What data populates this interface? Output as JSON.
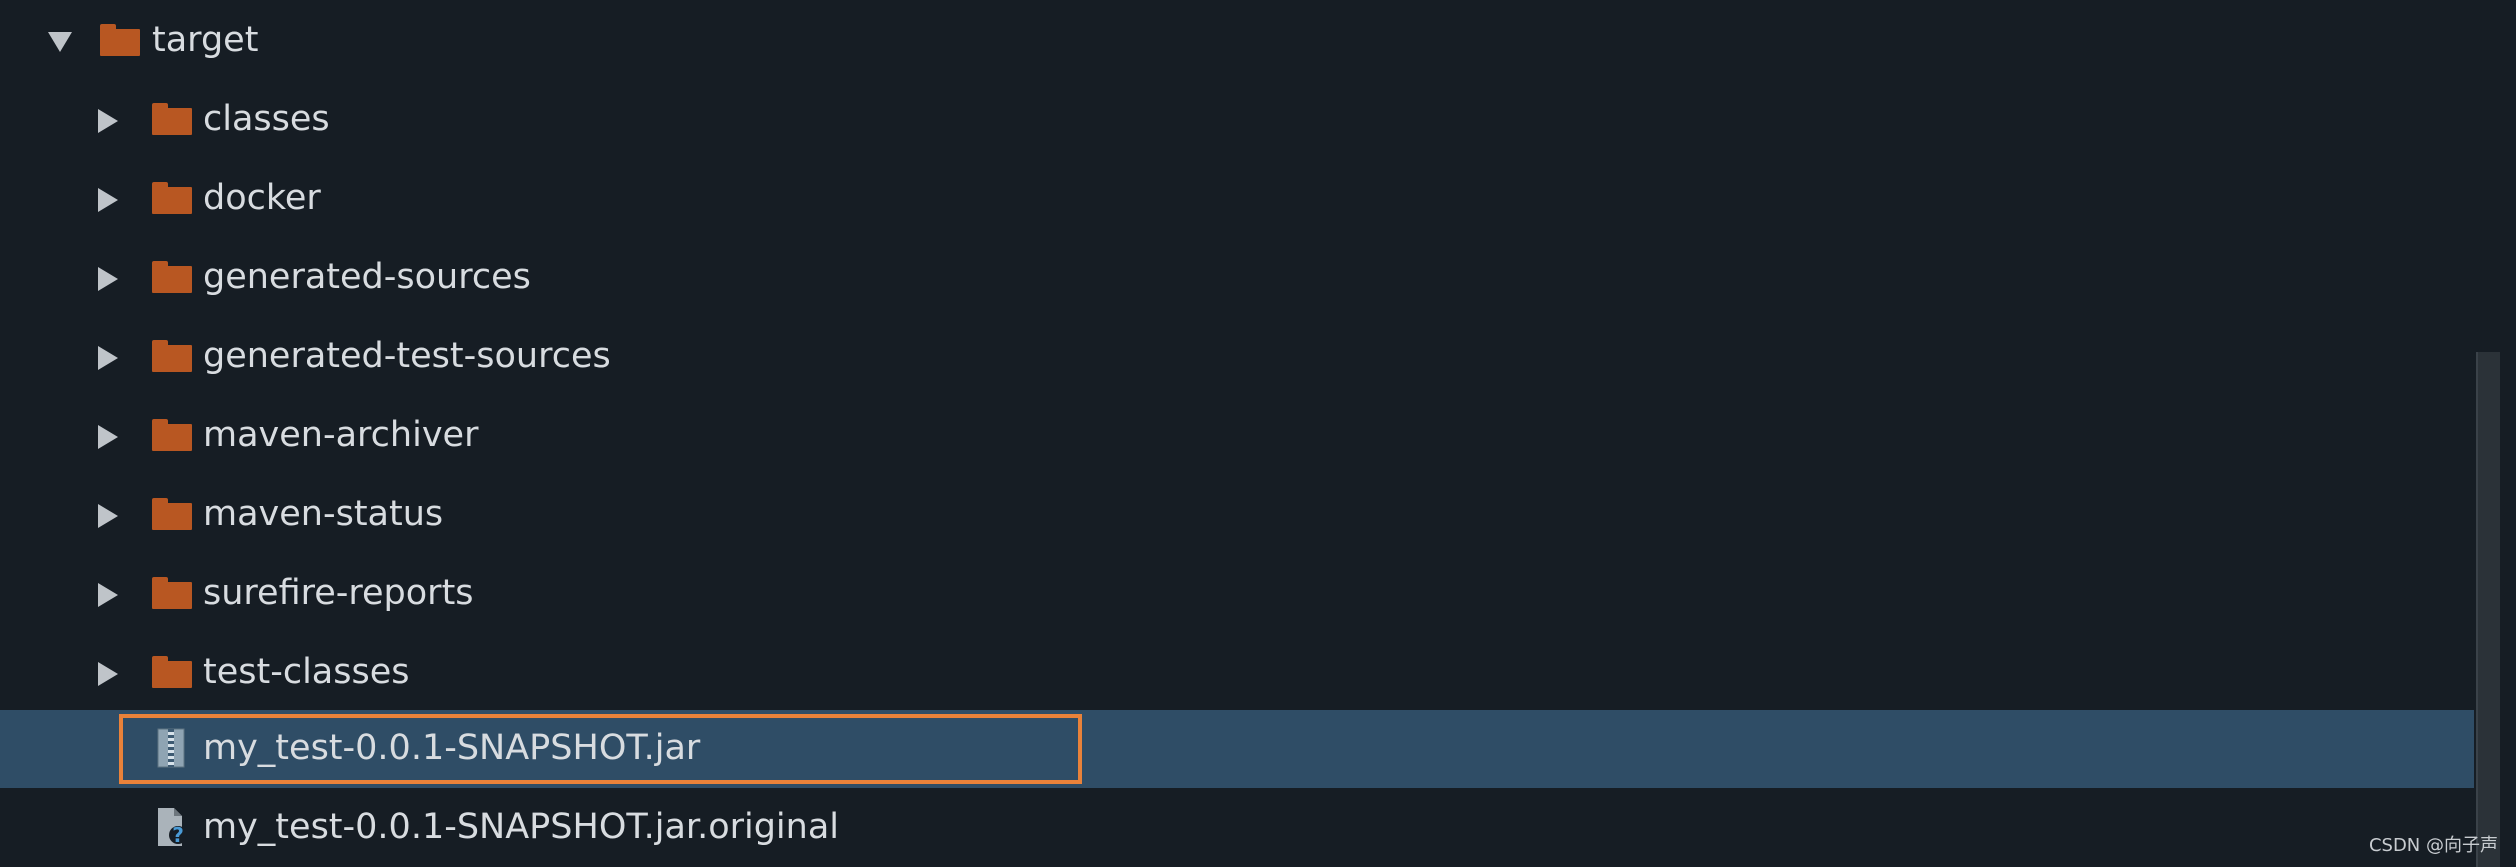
{
  "tree": {
    "root": {
      "label": "target",
      "expanded": true
    },
    "folders": [
      {
        "label": "classes"
      },
      {
        "label": "docker"
      },
      {
        "label": "generated-sources"
      },
      {
        "label": "generated-test-sources"
      },
      {
        "label": "maven-archiver"
      },
      {
        "label": "maven-status"
      },
      {
        "label": "surefire-reports"
      },
      {
        "label": "test-classes"
      }
    ],
    "files": [
      {
        "label": "my_test-0.0.1-SNAPSHOT.jar",
        "icon": "jar-archive-icon",
        "selected": true
      },
      {
        "label": "my_test-0.0.1-SNAPSHOT.jar.original",
        "icon": "unknown-file-icon",
        "selected": false
      }
    ]
  },
  "watermark": "CSDN @向子声",
  "colors": {
    "background": "#161d24",
    "folder": "#b85722",
    "selection": "#2f4d66",
    "highlight_border": "#e9823a",
    "text": "#d8dce0"
  }
}
